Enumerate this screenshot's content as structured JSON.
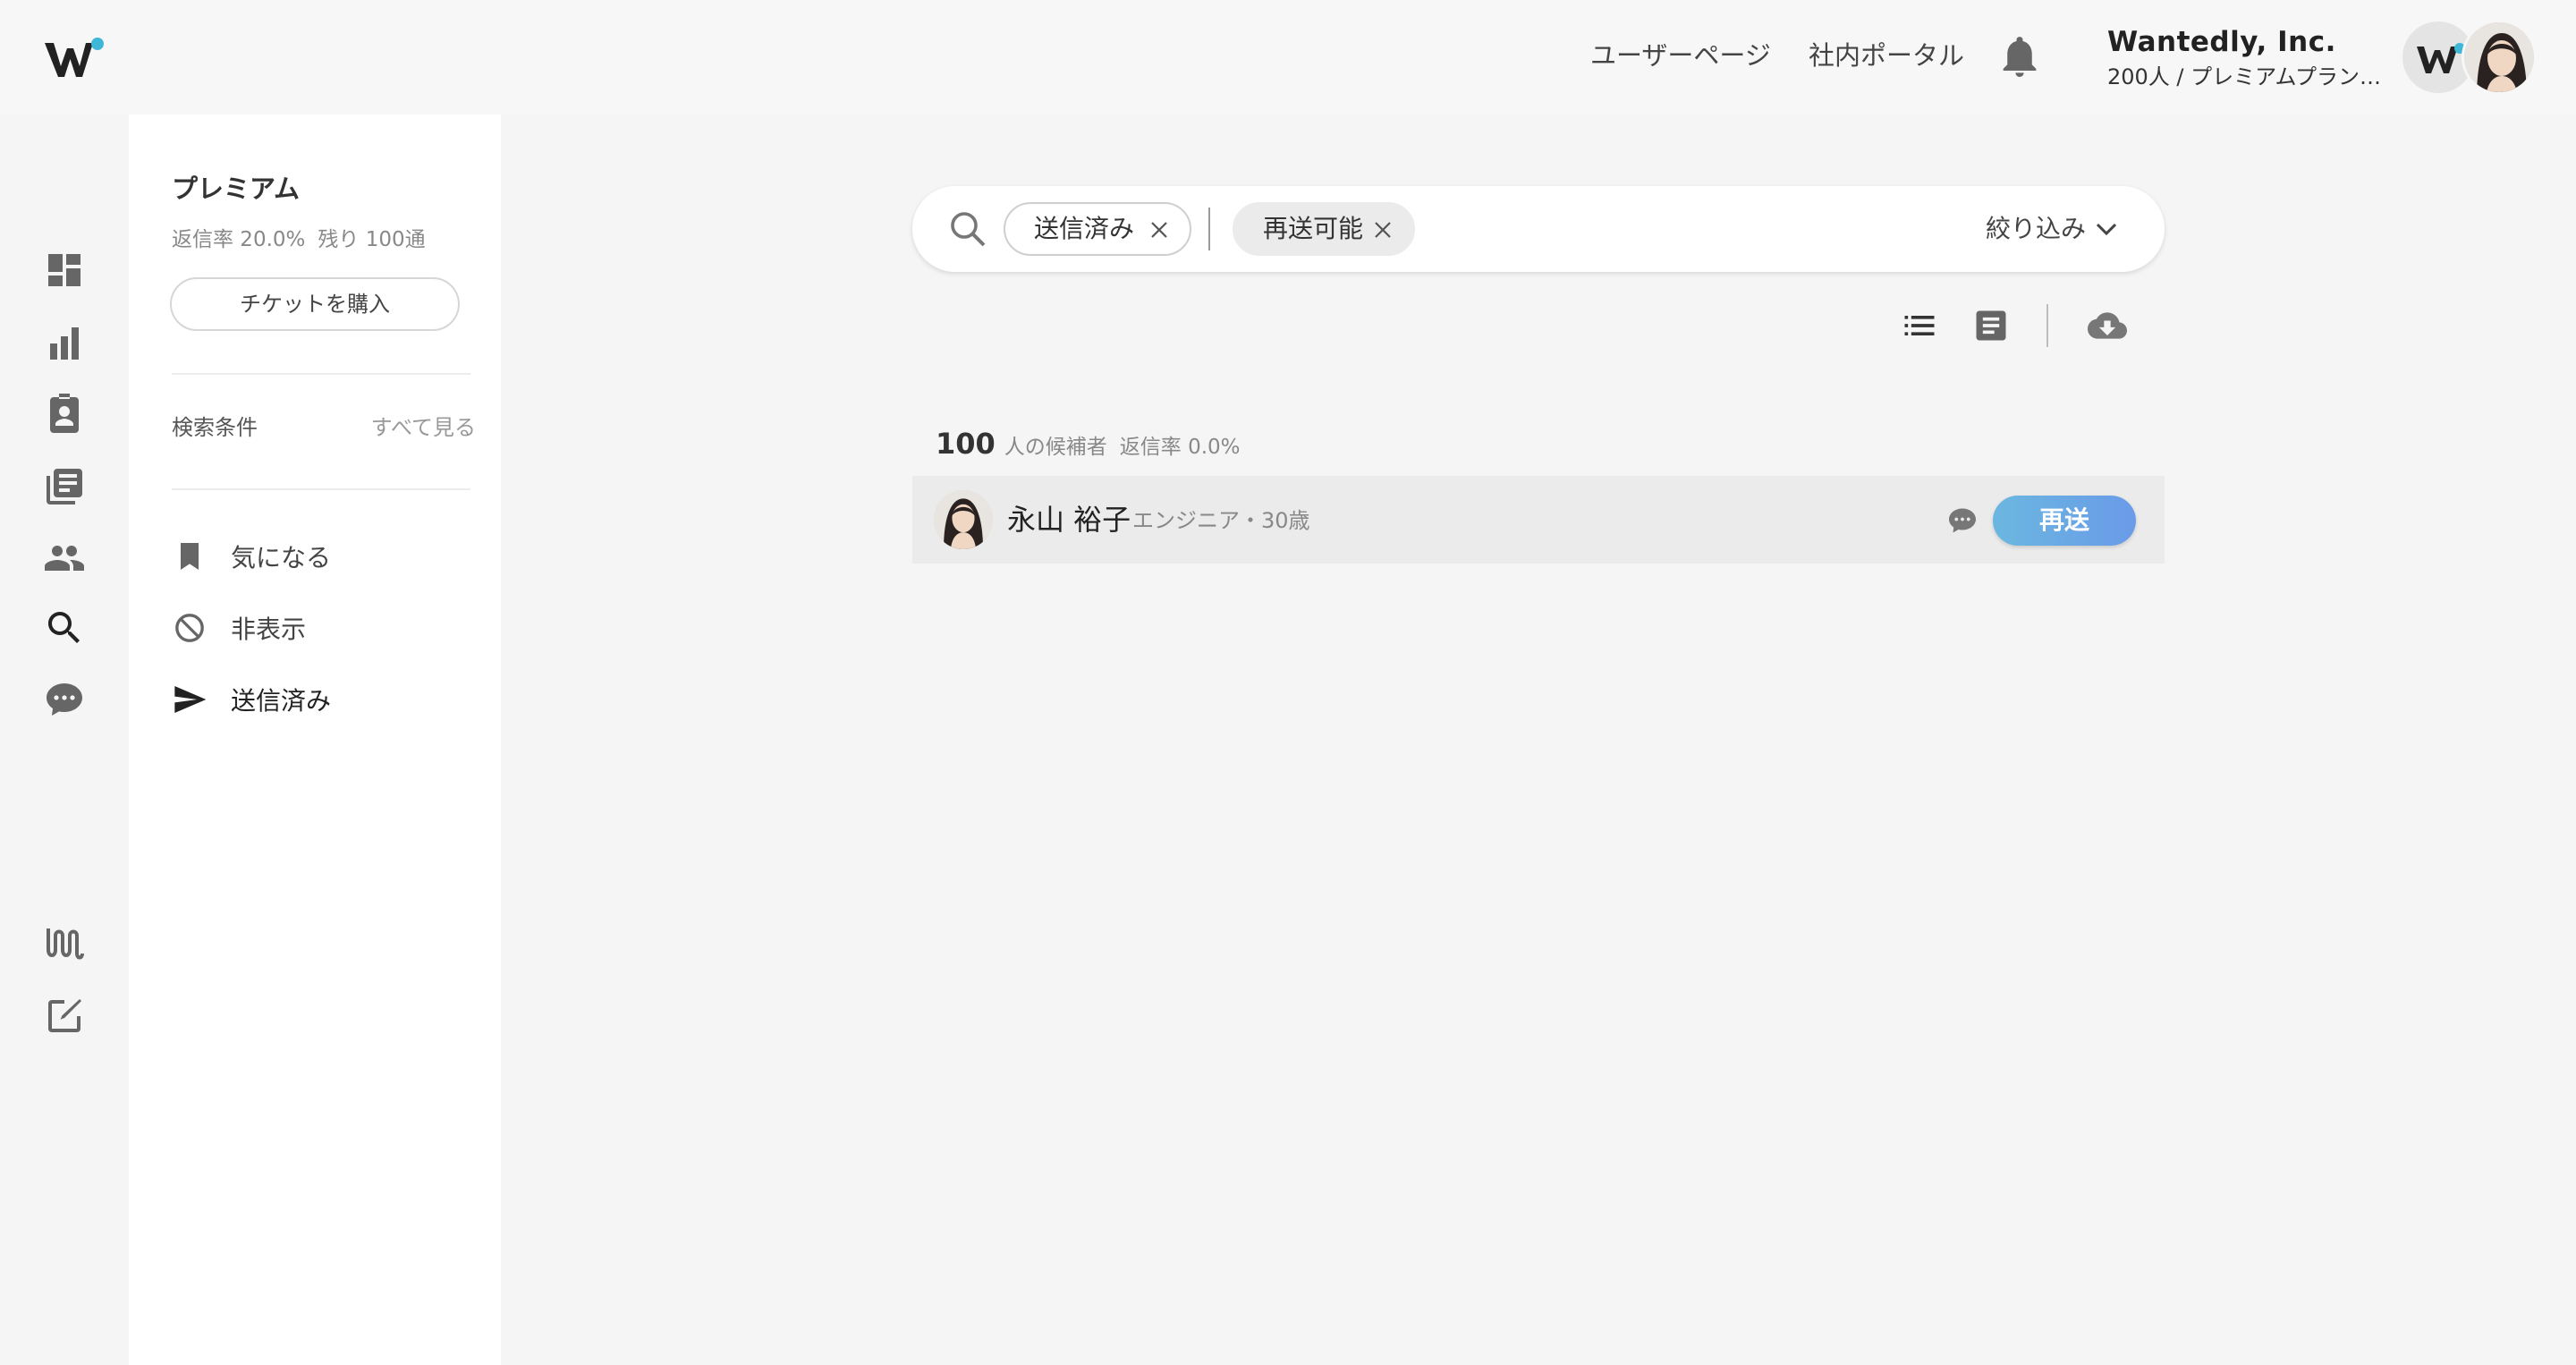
{
  "header": {
    "user_page_label": "ユーザーページ",
    "portal_label": "社内ポータル",
    "company_name": "Wantedly, Inc.",
    "company_plan": "200人 / プレミアムプラン ..."
  },
  "rail": {
    "icons": [
      "dashboard-icon",
      "bar-chart-icon",
      "contact-card-icon",
      "document-list-icon",
      "people-icon",
      "search-icon",
      "chat-bubble-icon",
      "wantedly-story-icon",
      "edit-icon"
    ]
  },
  "panel": {
    "title": "プレミアム",
    "reply_rate": "返信率 20.0%",
    "remaining": "残り 100通",
    "ticket_button": "チケットを購入",
    "conditions_label": "検索条件",
    "see_all_label": "すべて見る",
    "menu": [
      {
        "label": "気になる",
        "icon": "bookmark-icon"
      },
      {
        "label": "非表示",
        "icon": "hidden-icon"
      },
      {
        "label": "送信済み",
        "icon": "send-icon"
      }
    ]
  },
  "search": {
    "chips": [
      "送信済み",
      "再送可能"
    ],
    "filter_label": "絞り込み"
  },
  "results": {
    "count": "100",
    "count_label": "人の候補者",
    "reply_rate": "返信率 0.0%",
    "candidates": [
      {
        "name": "永山 裕子",
        "meta": "エンジニア・30歳",
        "action": "再送"
      }
    ]
  },
  "colors": {
    "accent": "#6aaae4",
    "brand_dot": "#3eb6d8",
    "icon": "#666666"
  }
}
